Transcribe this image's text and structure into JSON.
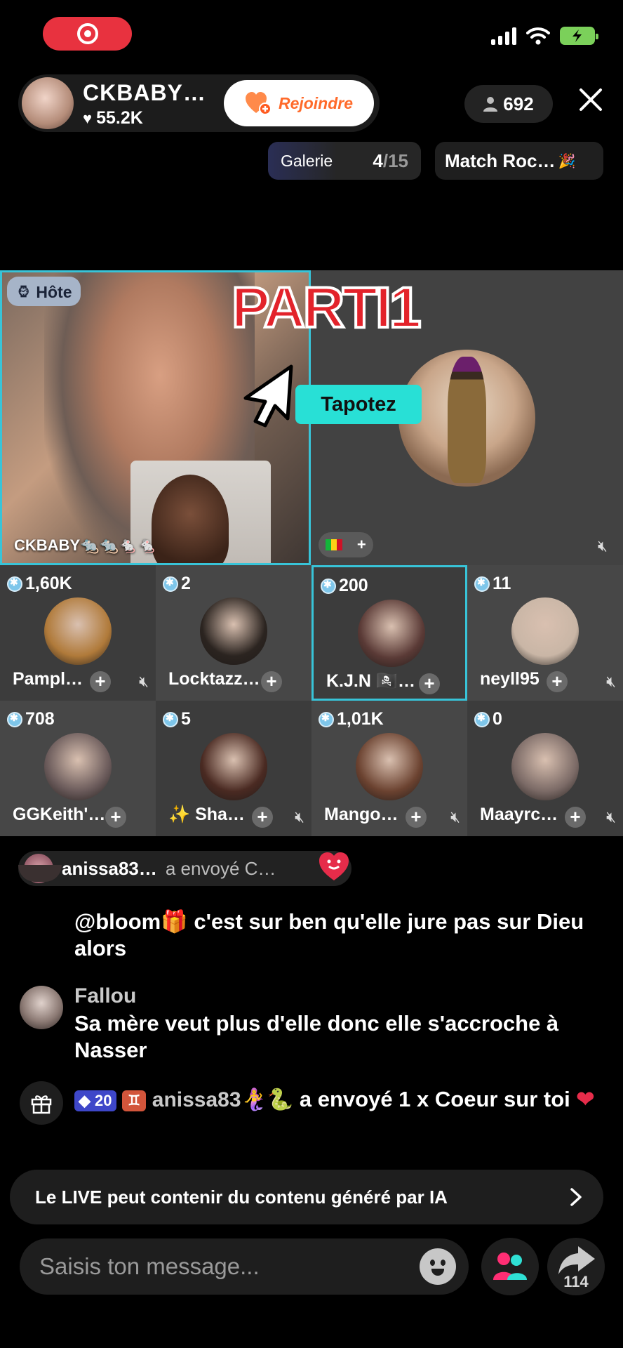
{
  "status": {
    "battery": "charging"
  },
  "host": {
    "name": "CKBABY…",
    "likes": "55.2K",
    "join_label": "Rejoindre"
  },
  "viewers": "692",
  "gallery": {
    "label": "Galerie",
    "current": "4",
    "total": "/15"
  },
  "match": {
    "label": "Match Roc…"
  },
  "stage": {
    "host_badge": "Hôte",
    "host_tile_name": "CKBABY🐀🐀🐁🐁",
    "overlay_title": "PARTI1",
    "tap_label": "Tapotez"
  },
  "guests": [
    {
      "score": "1,60K",
      "name": "Pampl…",
      "muted": true,
      "color": "#b07a3a"
    },
    {
      "score": "2",
      "name": "Locktazz…",
      "muted": false,
      "color": "#2b2420"
    },
    {
      "score": "200",
      "name": "K.J.N 🏴‍☠️…",
      "muted": false,
      "color": "#5a3a36"
    },
    {
      "score": "11",
      "name": "neyll95",
      "muted": true,
      "color": "#c9b6a6"
    },
    {
      "score": "708",
      "name": "GGKeith'…",
      "muted": false,
      "color": "#6a5a5a"
    },
    {
      "score": "5",
      "name": "✨ Sha…",
      "muted": true,
      "color": "#4a2a22"
    },
    {
      "score": "1,01K",
      "name": "Mango…",
      "muted": true,
      "color": "#6b4230"
    },
    {
      "score": "0",
      "name": "Maayrc…",
      "muted": true,
      "color": "#7b6a66"
    }
  ],
  "gift_banner": {
    "user": "anissa83…",
    "text": "a envoyé  C…"
  },
  "chat": [
    {
      "user": "",
      "text": "@bloom🎁 c'est sur ben qu'elle jure pas sur Dieu alors"
    },
    {
      "user": "Fallou",
      "text": "Sa mère veut plus d'elle donc elle s'accroche à Nasser"
    }
  ],
  "gift_message": {
    "diamonds": "20",
    "user": "anissa83🧜‍♀️🐍",
    "text": "a envoyé 1 x Coeur sur toi"
  },
  "ai_notice": "Le LIVE peut contenir du contenu généré par IA",
  "input": {
    "placeholder": "Saisis ton message..."
  },
  "share_count": "114"
}
